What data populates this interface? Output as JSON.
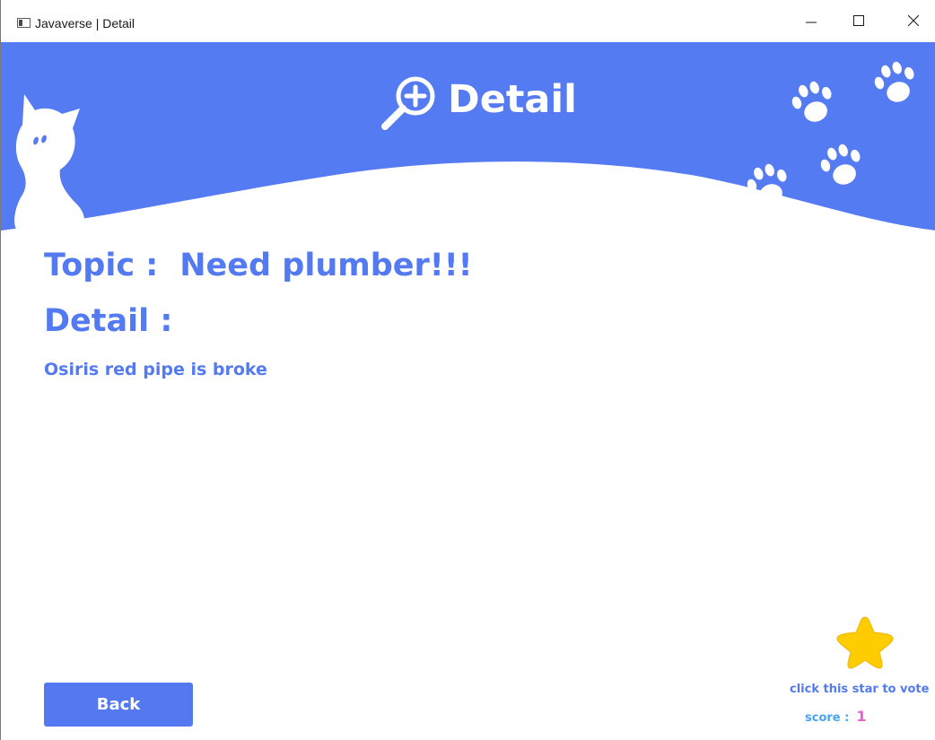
{
  "window": {
    "title": "Javaverse | Detail",
    "controls": {
      "minimize": "minimize-icon",
      "maximize": "maximize-icon",
      "close": "close-icon"
    }
  },
  "header": {
    "title": "Detail",
    "icon": "zoom-in-magnifier-icon",
    "background_color": "#557bf2",
    "decorations": [
      "cat-silhouette",
      "paw-print-icon"
    ]
  },
  "content": {
    "topic_label": "Topic :",
    "topic_value": "Need plumber!!!",
    "detail_label": "Detail :",
    "detail_text": "Osiris red pipe is broke",
    "text_color": "#537af0"
  },
  "actions": {
    "back_label": "Back",
    "back_color": "#5478f0"
  },
  "vote": {
    "star_icon": "star-icon",
    "star_color": "#ffcc00",
    "hint": "click this star to vote",
    "score_label": "score :",
    "score_value": "1",
    "score_label_color": "#4aa3f0",
    "score_value_color": "#e85fd0"
  }
}
